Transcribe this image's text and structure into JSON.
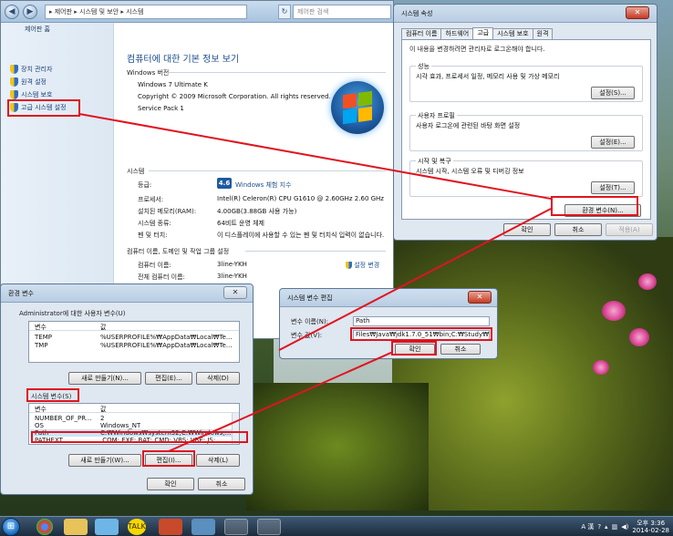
{
  "explorer": {
    "breadcrumb": "▸ 제어판 ▸ 시스템 및 보안 ▸ 시스템",
    "search_placeholder": "제어판 검색",
    "left_title": "제어판 홈",
    "left_items": [
      "장치 관리자",
      "원격 설정",
      "시스템 보호",
      "고급 시스템 설정"
    ],
    "main_title": "컴퓨터에 대한 기본 정보 보기",
    "windows_section": "Windows 버전",
    "edition": "Windows 7 Ultimate K",
    "copyright": "Copyright © 2009 Microsoft Corporation. All rights reserved.",
    "service_pack": "Service Pack 1",
    "system_section": "시스템",
    "rating_label": "등급:",
    "rating_score": "4.6",
    "rating_link": "Windows 체험 지수",
    "processor_label": "프로세서:",
    "processor_value": "Intel(R) Celeron(R) CPU G1610 @ 2.60GHz   2.60 GHz",
    "ram_label": "설치된 메모리(RAM):",
    "ram_value": "4.00GB(3.88GB 사용 가능)",
    "systype_label": "시스템 종류:",
    "systype_value": "64비트 운영 체제",
    "pen_label": "펜 및 터치:",
    "pen_value": "이 디스플레이에 사용할 수 있는 펜 및 터치식 입력이 없습니다.",
    "network_section": "컴퓨터 이름, 도메인 및 작업 그룹 설정",
    "computer_name_label": "컴퓨터 이름:",
    "computer_name_value": "3line-YKH",
    "full_name_label": "전체 컴퓨터 이름:",
    "full_name_value": "3line-YKH",
    "change_settings": "설정 변경"
  },
  "sysprop": {
    "title": "시스템 속성",
    "tabs": [
      "컴퓨터 이름",
      "하드웨어",
      "고급",
      "시스템 보호",
      "원격"
    ],
    "admin_note": "이 내용을 변경하려면 관리자로 로그온해야 합니다.",
    "groups": [
      {
        "title": "성능",
        "desc": "시각 효과, 프로세서 일정, 메모리 사용 및 가상 메모리",
        "button": "설정(S)..."
      },
      {
        "title": "사용자 프로필",
        "desc": "사용자 로그온에 관련된 바탕 화면 설정",
        "button": "설정(E)..."
      },
      {
        "title": "시작 및 복구",
        "desc": "시스템 시작, 시스템 오류 및 디버깅 정보",
        "button": "설정(T)..."
      }
    ],
    "env_button": "환경 변수(N)...",
    "ok": "확인",
    "cancel": "취소",
    "apply": "적용(A)"
  },
  "env": {
    "title": "환경 변수",
    "user_section": "Administrator에 대한 사용자 변수(U)",
    "col_var": "변수",
    "col_val": "값",
    "user_vars": [
      {
        "name": "TEMP",
        "value": "%USERPROFILE%₩AppData₩Local₩Te..."
      },
      {
        "name": "TMP",
        "value": "%USERPROFILE%₩AppData₩Local₩Te..."
      }
    ],
    "user_new": "새로 만들기(N)...",
    "user_edit": "편집(E)...",
    "user_delete": "삭제(D)",
    "system_section": "시스템 변수(S)",
    "system_vars": [
      {
        "name": "NUMBER_OF_PR...",
        "value": "2"
      },
      {
        "name": "OS",
        "value": "Windows_NT"
      },
      {
        "name": "Path",
        "value": "C:₩Windows₩system32;C:₩Windows;..."
      },
      {
        "name": "PATHEXT",
        "value": ".COM;.EXE;.BAT;.CMD;.VBS;.VBE;.JS;..."
      }
    ],
    "system_new": "새로 만들기(W)...",
    "system_edit": "편집(I)...",
    "system_delete": "삭제(L)",
    "ok": "확인",
    "cancel": "취소"
  },
  "edit_dialog": {
    "title": "시스템 변수 편집",
    "name_label": "변수 이름(N):",
    "name_value": "Path",
    "value_label": "변수 값(V):",
    "value_value": "Files₩Java₩jdk1.7.0_51₩bin;C:₩Study₩bin",
    "ok": "확인",
    "cancel": "취소"
  },
  "taskbar": {
    "tray_lang": "A 漢",
    "time": "오후 3:36",
    "date": "2014-02-28"
  }
}
